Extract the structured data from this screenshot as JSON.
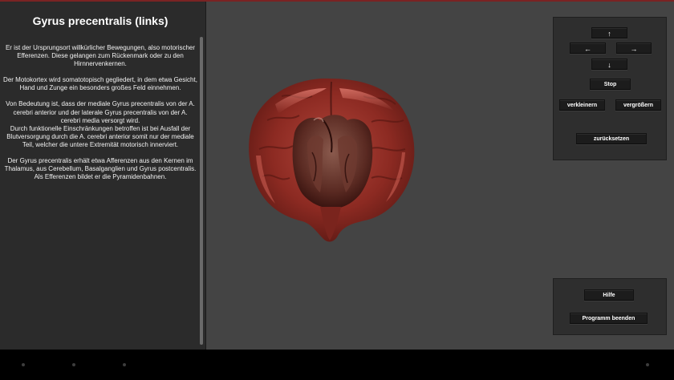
{
  "info": {
    "title": "Gyrus precentralis (links)",
    "paragraphs": [
      "Er ist der Ursprungsort willkürlicher Bewegungen, also motorischer Efferenzen. Diese gelangen zum Rückenmark oder zu den Hirnnervenkernen.",
      "Der Motokortex wird somatotopisch gegliedert, in dem etwa Gesicht, Hand und Zunge ein besonders großes Feld einnehmen.",
      "Von Bedeutung ist, dass der mediale Gyrus precentralis von der A. cerebri anterior und der laterale Gyrus precentralis von der A. cerebri media versorgt wird.",
      "Durch funktionelle Einschränkungen betroffen ist bei Ausfall der Blutversorgung durch die A. cerebri anterior somit nur der mediale Teil, welcher die untere Extremität motorisch innerviert.",
      "Der Gyrus precentralis erhält etwa Afferenzen aus den Kernen im Thalamus, aus Cerebellum, Basalganglien und Gyrus postcentralis. Als Efferenzen bildet er die Pyramidenbahnen."
    ]
  },
  "controls": {
    "up": "↑",
    "left": "←",
    "right": "→",
    "down": "↓",
    "stop": "Stop",
    "zoom_out": "verkleinern",
    "zoom_in": "vergrößern",
    "reset": "zurücksetzen"
  },
  "app_controls": {
    "help": "Hilfe",
    "quit": "Programm beenden"
  },
  "colors": {
    "brain_base": "#8c2a22",
    "brain_highlight": "#c8564a",
    "brain_dark": "#4a1512",
    "panel_bg": "#2b2b2b",
    "viewport_bg": "#444444",
    "button_bg": "#1c1c1c"
  }
}
